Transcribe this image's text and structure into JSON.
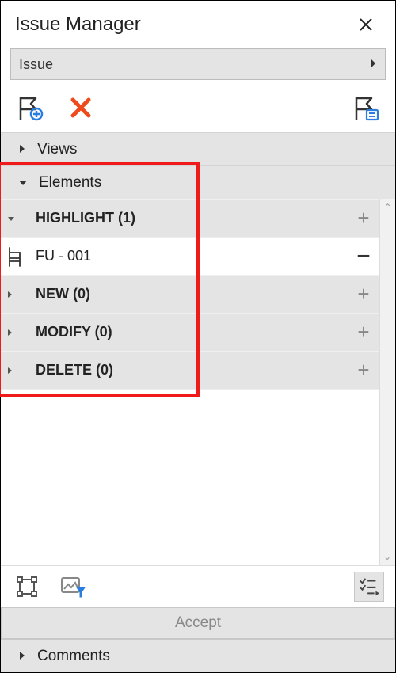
{
  "window": {
    "title": "Issue Manager"
  },
  "dropdown": {
    "selected": "Issue"
  },
  "sections": {
    "views": {
      "label": "Views",
      "expanded": false
    },
    "elements": {
      "label": "Elements",
      "expanded": true
    },
    "comments": {
      "label": "Comments",
      "expanded": false
    }
  },
  "elements": {
    "categories": [
      {
        "key": "highlight",
        "label": "HIGHLIGHT (1)"
      },
      {
        "key": "new",
        "label": "NEW (0)"
      },
      {
        "key": "modify",
        "label": "MODIFY (0)"
      },
      {
        "key": "delete",
        "label": "DELETE (0)"
      }
    ],
    "highlight_items": [
      {
        "label": "FU - 001",
        "icon": "chair-icon"
      }
    ]
  },
  "buttons": {
    "accept": "Accept"
  }
}
